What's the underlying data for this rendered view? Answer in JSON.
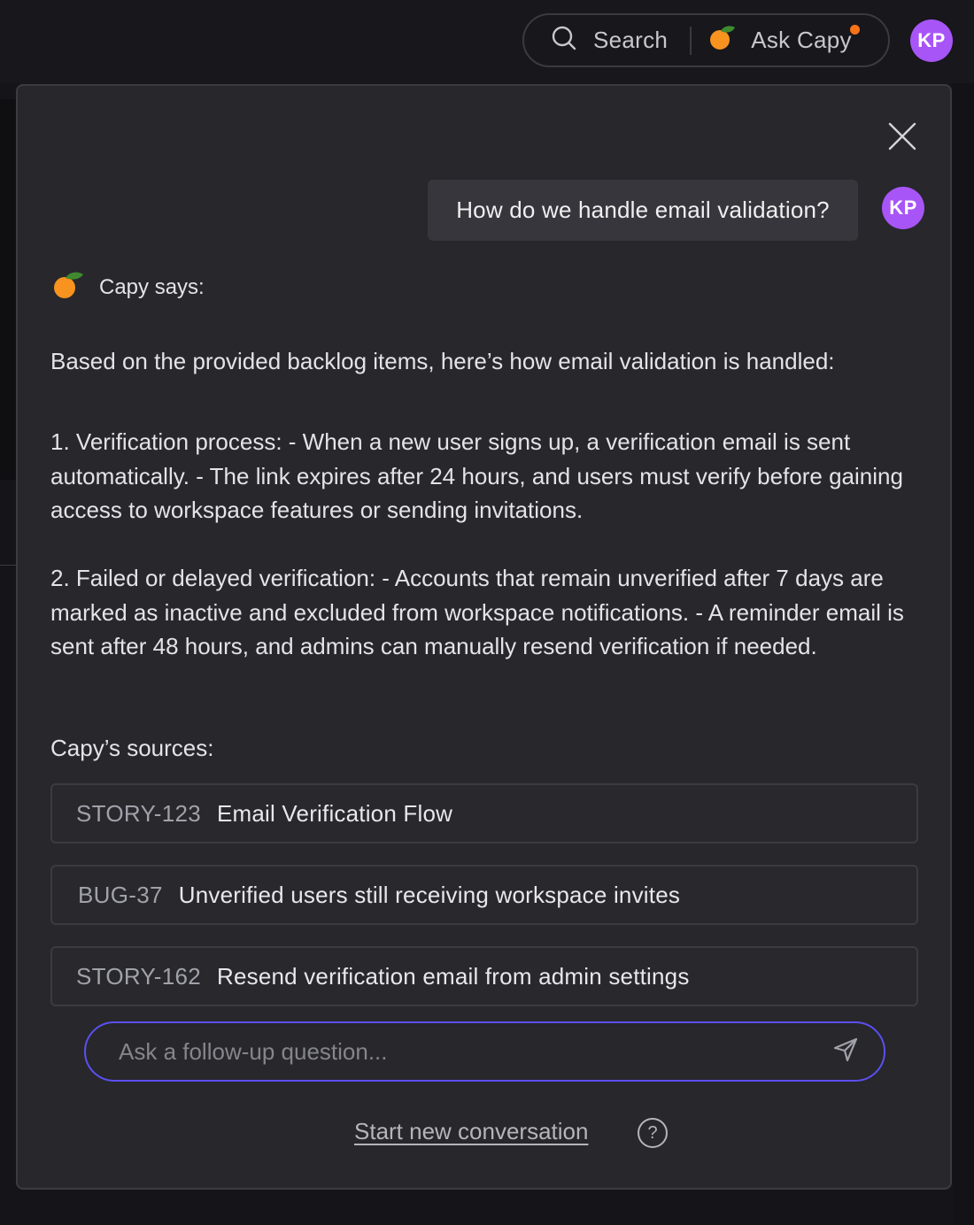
{
  "header": {
    "search_label": "Search",
    "ask_label": "Ask Capy",
    "user_initials": "KP"
  },
  "panel": {
    "user_question": "How do we handle email validation?",
    "user_initials": "KP",
    "assistant_label": "Capy says:",
    "answer_intro": "Based on the provided backlog items, here’s how email validation is handled:",
    "answer_items": [
      "1. Verification process: - When a new user signs up, a verification email is sent automatically. - The link expires after 24 hours, and users must verify before gaining access to workspace features or sending invitations.",
      "2. Failed or delayed verification: - Accounts that remain unverified after 7 days are marked as inactive and excluded from workspace notifications. - A reminder email is sent after 48 hours, and admins can manually resend verification if needed."
    ],
    "sources_heading": "Capy’s sources:",
    "sources": [
      {
        "id": "STORY-123",
        "title": "Email Verification Flow"
      },
      {
        "id": "BUG-37",
        "title": "Unverified users still receiving workspace invites"
      },
      {
        "id": "STORY-162",
        "title": "Resend verification email from admin settings"
      }
    ],
    "followup_placeholder": "Ask a follow-up question...",
    "new_conversation_label": "Start new conversation",
    "help_glyph": "?"
  },
  "colors": {
    "accent": "#5b50f0",
    "avatar": "#a855f7",
    "notification": "#f97316",
    "panel_bg": "#27272c"
  },
  "icons": [
    "search-icon",
    "capy-orange-icon",
    "close-icon",
    "send-icon",
    "help-icon"
  ]
}
